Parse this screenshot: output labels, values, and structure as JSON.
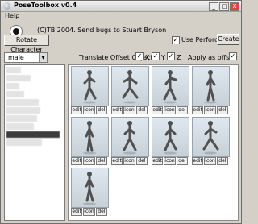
{
  "window": {
    "title": "PoseToolbox v0.4",
    "controls": [
      "_",
      "□",
      "X"
    ]
  },
  "menu": {
    "help": "Help"
  },
  "header": {
    "credits": "(C)TB 2004. Send bugs to Stuart Bryson",
    "rotate_button": "Rotate Character",
    "use_perforce_label": "Use Perforce",
    "use_perforce_checked": "✓",
    "create_button": "Create"
  },
  "controls": {
    "character_select": "male",
    "translate_label": "Translate Offset Object:",
    "axis_x": "X",
    "axis_y": "Y",
    "axis_z": "Z",
    "checked_mark": "✓",
    "apply_offset_label": "Apply as offset:"
  },
  "pose_list": {
    "items": [
      "",
      "",
      "",
      "",
      "",
      "",
      "",
      "",
      "",
      ""
    ]
  },
  "thumbnail_actions": {
    "edit": "edit",
    "icon": "icon",
    "del": "del"
  }
}
